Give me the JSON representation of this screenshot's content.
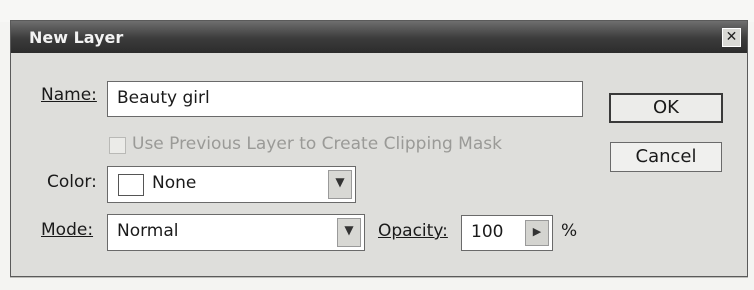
{
  "dialog": {
    "title": "New Layer",
    "close_glyph": "✕",
    "name_label": "Name:",
    "name_value": "Beauty girl",
    "clipping_mask_label": "Use Previous Layer to Create Clipping Mask",
    "clipping_mask_checked": false,
    "clipping_mask_enabled": false,
    "color_label": "Color:",
    "color_value": "None",
    "mode_label": "Mode:",
    "mode_value": "Normal",
    "opacity_label": "Opacity:",
    "opacity_value": "100",
    "opacity_unit": "%",
    "ok_label": "OK",
    "cancel_label": "Cancel"
  },
  "icons": {
    "close": "close-icon",
    "dropdown": "chevron-down-icon",
    "stepper": "triangle-right-icon"
  },
  "colors": {
    "titlebar": "#3b3b3b",
    "dialog_bg": "#dededb",
    "disabled_text": "#9a9a97"
  }
}
